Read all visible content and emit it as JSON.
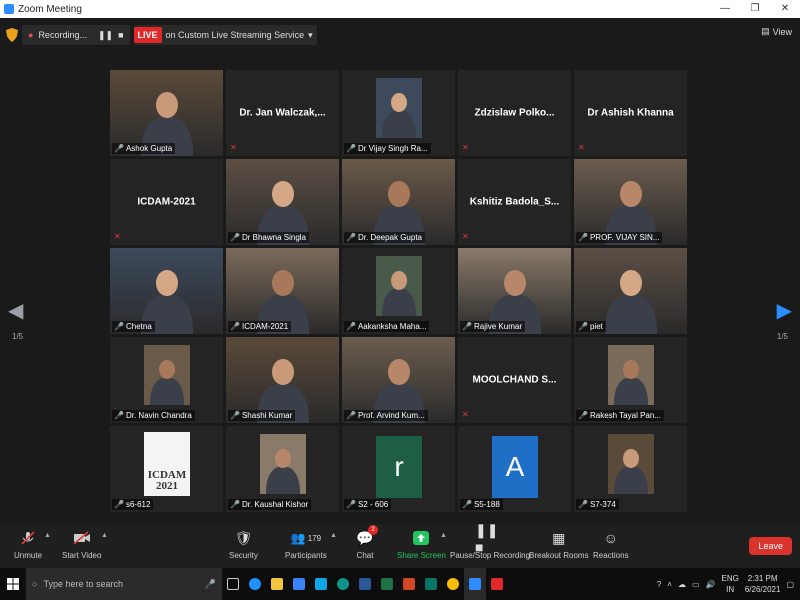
{
  "window": {
    "title": "Zoom Meeting"
  },
  "recording": {
    "label": "Recording...",
    "live_badge": "LIVE",
    "stream_label": "on Custom Live Streaming Service"
  },
  "view_label": "View",
  "pager": {
    "left": "1/5",
    "right": "1/5"
  },
  "tiles": [
    {
      "name": "Ashok Gupta",
      "big": "",
      "type": "video",
      "active": true
    },
    {
      "name": "",
      "big": "Dr. Jan Walczak,...",
      "type": "name"
    },
    {
      "name": "Dr Vijay Singh Ra...",
      "big": "",
      "type": "photo"
    },
    {
      "name": "",
      "big": "Zdzislaw Polko...",
      "type": "name"
    },
    {
      "name": "",
      "big": "Dr Ashish Khanna",
      "type": "name"
    },
    {
      "name": "",
      "big": "ICDAM-2021",
      "type": "name"
    },
    {
      "name": "Dr Bhawna Singla",
      "big": "",
      "type": "video"
    },
    {
      "name": "Dr. Deepak Gupta",
      "big": "",
      "type": "video"
    },
    {
      "name": "",
      "big": "Kshitiz Badola_S...",
      "type": "name"
    },
    {
      "name": "PROF. VIJAY SIN...",
      "big": "",
      "type": "video"
    },
    {
      "name": "Chetna",
      "big": "",
      "type": "video"
    },
    {
      "name": "ICDAM-2021",
      "big": "",
      "type": "video"
    },
    {
      "name": "Aakanksha Maha...",
      "big": "",
      "type": "photo"
    },
    {
      "name": "Rajive Kumar",
      "big": "",
      "type": "video"
    },
    {
      "name": "piet",
      "big": "",
      "type": "video"
    },
    {
      "name": "Dr. Navin Chandra",
      "big": "",
      "type": "photo"
    },
    {
      "name": "Shashi Kumar",
      "big": "",
      "type": "video"
    },
    {
      "name": "Prof. Arvind Kum...",
      "big": "",
      "type": "video"
    },
    {
      "name": "",
      "big": "MOOLCHAND S...",
      "type": "name"
    },
    {
      "name": "Rakesh Tayal Pan...",
      "big": "",
      "type": "photo"
    },
    {
      "name": "s6-612",
      "big": "",
      "type": "poster"
    },
    {
      "name": "Dr. Kaushal Kishor",
      "big": "",
      "type": "photo"
    },
    {
      "name": "S2 - 606",
      "big": "",
      "type": "avatar",
      "letter": "r",
      "color": "#1e5e45"
    },
    {
      "name": "S5-188",
      "big": "",
      "type": "avatar",
      "letter": "A",
      "color": "#1f6fc6"
    },
    {
      "name": "S7-374",
      "big": "",
      "type": "photo"
    }
  ],
  "poster_text": "ICDAM 2021",
  "toolbar": {
    "unmute": "Unmute",
    "start_video": "Start Video",
    "security": "Security",
    "participants": "Participants",
    "participants_count": "179",
    "chat": "Chat",
    "chat_badge": "2",
    "share_screen": "Share Screen",
    "pause_recording": "Pause/Stop Recording",
    "breakout": "Breakout Rooms",
    "reactions": "Reactions",
    "leave": "Leave"
  },
  "taskbar": {
    "search_placeholder": "Type here to search",
    "lang_top": "ENG",
    "lang_bottom": "IN",
    "time": "2:31 PM",
    "date": "6/26/2021"
  },
  "colors": {
    "accent_green": "#b5d44a",
    "live_red": "#e02828",
    "share_green": "#22c55e",
    "leave_red": "#d9332b",
    "nav_blue": "#2d8cff"
  }
}
